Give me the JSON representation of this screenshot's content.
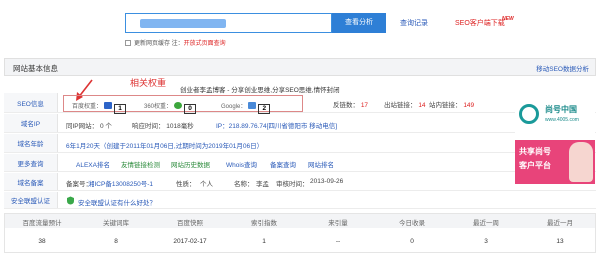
{
  "top": {
    "search_button": "查看分析",
    "history_link": "查询记录",
    "customer_link": "SEO客户端下载",
    "new_badge": "NEW",
    "checkbox_label": "更新网页缓存 注：",
    "checkbox_link": "开放式页面查询"
  },
  "card": {
    "title": "网站基本信息",
    "mobile_link": "移动SEO数据分析",
    "annotation": "相关权重",
    "site_title": "创业者李孟博客 - 分享创业思维,分享SEO思维,情怀封闭"
  },
  "seo": {
    "label": "SEO信息",
    "baidu_label": "百度权重：",
    "baidu_value": "1",
    "s360_label": "360权重：",
    "s360_value": "0",
    "google_label": "Google：",
    "google_value": "2",
    "backlinks_label": "反链数：",
    "backlinks_value": "17",
    "outlinks_label": "出站链接：",
    "outlinks_value": "14",
    "inlinks_label": "站内链接：",
    "inlinks_value": "149"
  },
  "domain_ip": {
    "label": "域名IP",
    "same_ip": "同IP网站： 0 个",
    "response": "响应时间： 1018毫秒",
    "ip": "IP：218.89.76.74[四川省德阳市 移动电信]"
  },
  "domain_age": {
    "label": "域名年龄",
    "text": "6年1月20天（创建于2011年01月06日,过期时间为2019年01月06日）"
  },
  "more": {
    "label": "更多查询",
    "links": [
      "ALEXA排名",
      "友情链接检测",
      "网站历史数据",
      "Whois查询",
      "备案查询",
      "网站排名"
    ]
  },
  "icp": {
    "label": "域名备案",
    "number_label": "备案号：",
    "number": "湘ICP备13008250号-1",
    "nature_label": "性质：",
    "nature": "个人",
    "name_label": "名称：",
    "name": "李孟",
    "date_label": "审核时间：",
    "date": "2013-09-26"
  },
  "security": {
    "label": "安全联盟认证",
    "text": "安全联盟认证有什么好处？"
  },
  "ad": {
    "brand": "尚号中国",
    "url": "www.4005.com",
    "line1": "共享尚号",
    "line2": "客户平台"
  },
  "stats": {
    "headers": [
      "百度流量预计",
      "关键词库",
      "百度快照",
      "索引指数",
      "来引量",
      "今日收录",
      "最近一周",
      "最近一月"
    ],
    "values": [
      "38",
      "8",
      "2017-02-17",
      "1",
      "--",
      "0",
      "3",
      "13"
    ]
  }
}
